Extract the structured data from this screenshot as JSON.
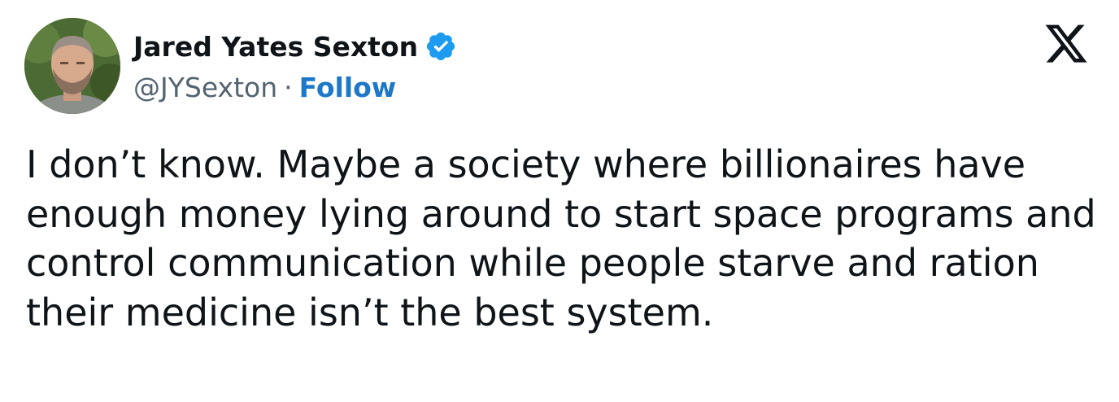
{
  "author": {
    "display_name": "Jared Yates Sexton",
    "handle": "@JYSexton",
    "separator": "·",
    "follow_label": "Follow",
    "verified": true,
    "avatar_icon": "profile-photo"
  },
  "platform": {
    "logo_icon": "x-logo"
  },
  "tweet": {
    "text": "I don’t know. Maybe a society where billionaires have enough money lying around to start space programs and control communication while people starve and ration their medicine isn’t the best system."
  },
  "colors": {
    "text": "#0f1419",
    "secondary_text": "#536471",
    "follow_link": "#1d78c8",
    "verified_badge": "#1d9bf0"
  }
}
